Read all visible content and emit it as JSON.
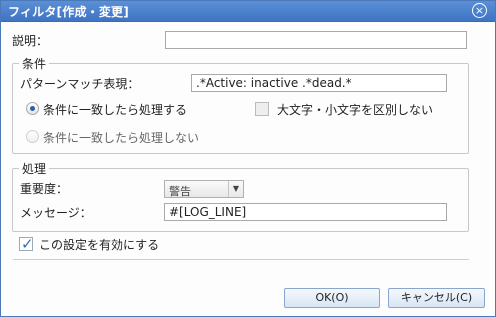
{
  "dialog": {
    "title": "フィルタ[作成・変更]",
    "close_symbol": "×"
  },
  "description": {
    "label": "説明：",
    "value": ""
  },
  "condition_group": {
    "legend": "条件",
    "pattern_label": "パターンマッチ表現：",
    "pattern_value": ".*Active: inactive .*dead.*",
    "radio_match": {
      "label": "条件に一致したら処理する",
      "checked": true
    },
    "radio_nomatch": {
      "label": "条件に一致したら処理しない",
      "checked": false
    },
    "case_insensitive": {
      "label": "大文字・小文字を区別しない",
      "checked": false
    }
  },
  "process_group": {
    "legend": "処理",
    "priority_label": "重要度：",
    "priority_value": "警告",
    "message_label": "メッセージ：",
    "message_value": "#[LOG_LINE]"
  },
  "enable": {
    "label": "この設定を有効にする",
    "checked": true
  },
  "buttons": {
    "ok": "OK(O)",
    "cancel": "キャンセル(C)"
  },
  "colors": {
    "titlebar": "#4a80cc",
    "accent": "#3a6bb3"
  }
}
